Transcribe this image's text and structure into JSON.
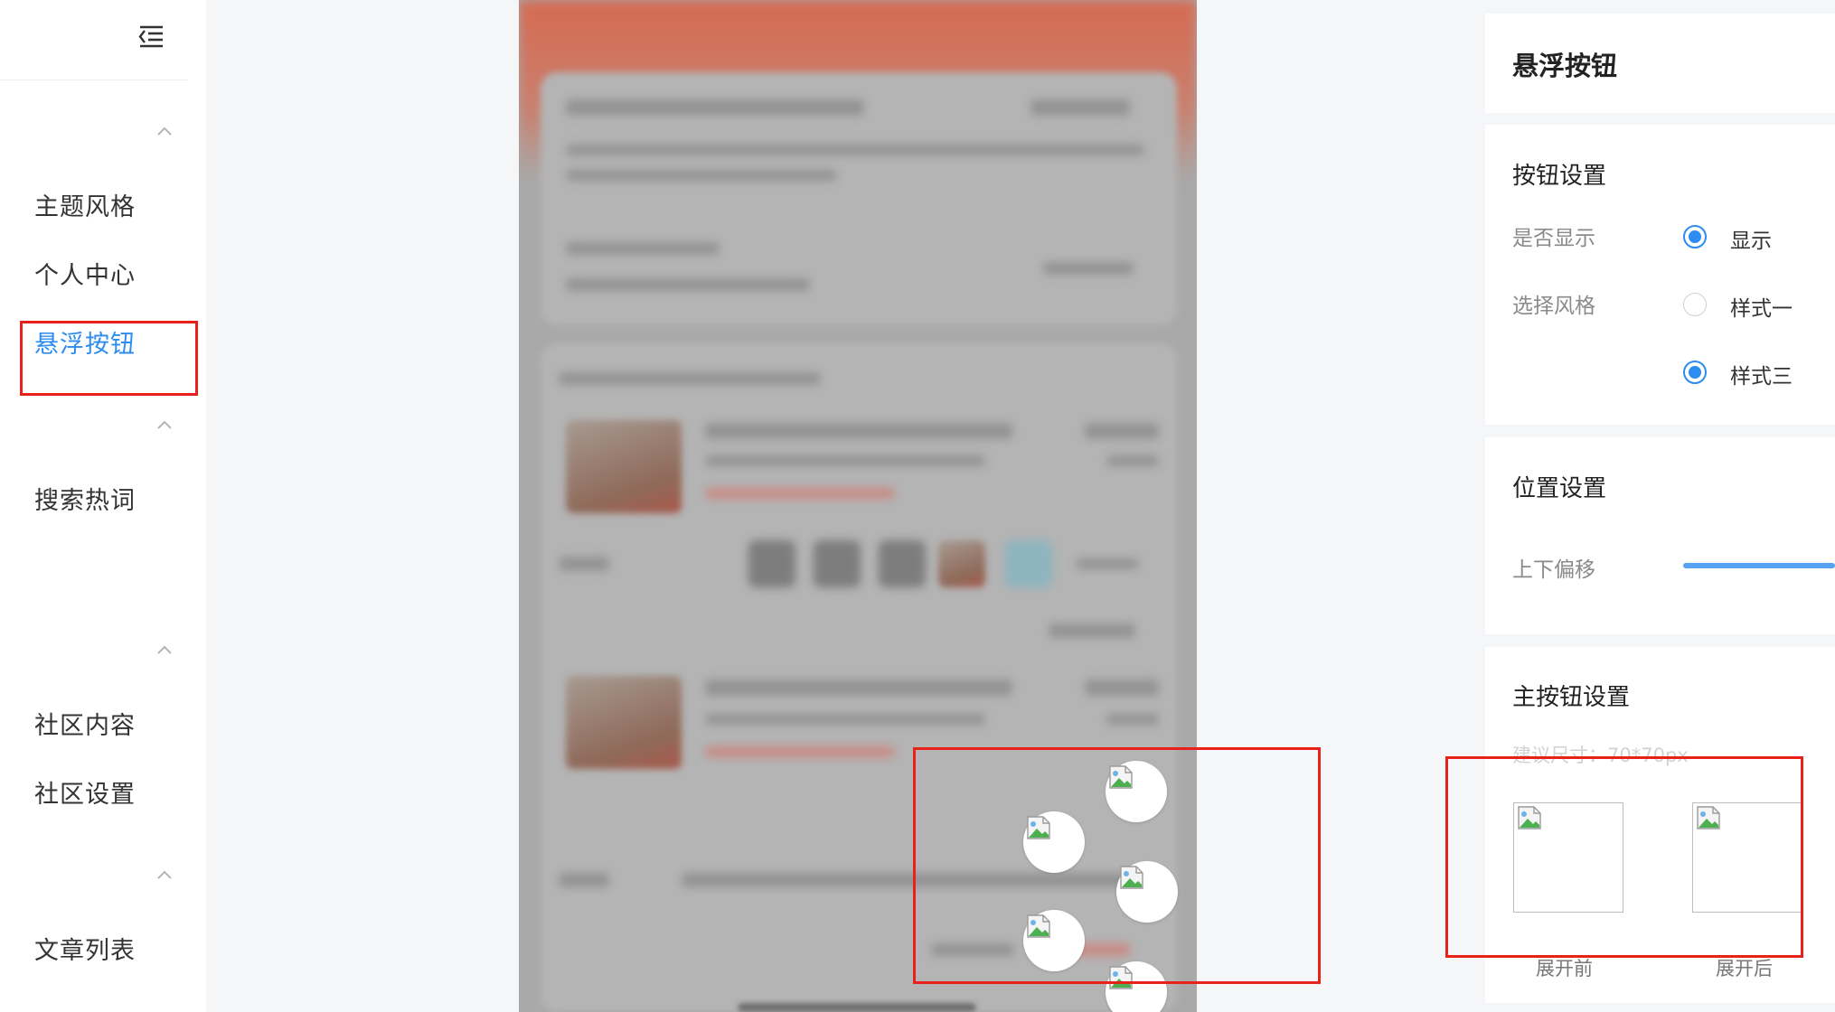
{
  "sidebar": {
    "items": [
      {
        "label": "主题风格"
      },
      {
        "label": "个人中心"
      },
      {
        "label": "悬浮按钮",
        "active": true
      },
      {
        "label": "搜索热词"
      },
      {
        "label": "社区内容"
      },
      {
        "label": "社区设置"
      },
      {
        "label": "文章列表"
      }
    ]
  },
  "panel": {
    "title": "悬浮按钮",
    "button_settings": {
      "title": "按钮设置",
      "show_label": "是否显示",
      "show_option": "显示",
      "show_selected": true,
      "style_label": "选择风格",
      "style_options": [
        {
          "label": "样式一",
          "selected": false
        },
        {
          "label": "样式三",
          "selected": true
        }
      ]
    },
    "position_settings": {
      "title": "位置设置",
      "offset_label": "上下偏移"
    },
    "main_button_settings": {
      "title": "主按钮设置",
      "size_hint": "建议尺寸：70*70px",
      "before_caption": "展开前",
      "after_caption": "展开后"
    }
  },
  "colors": {
    "accent": "#2d8cf0",
    "highlight_box": "#e8211a"
  }
}
